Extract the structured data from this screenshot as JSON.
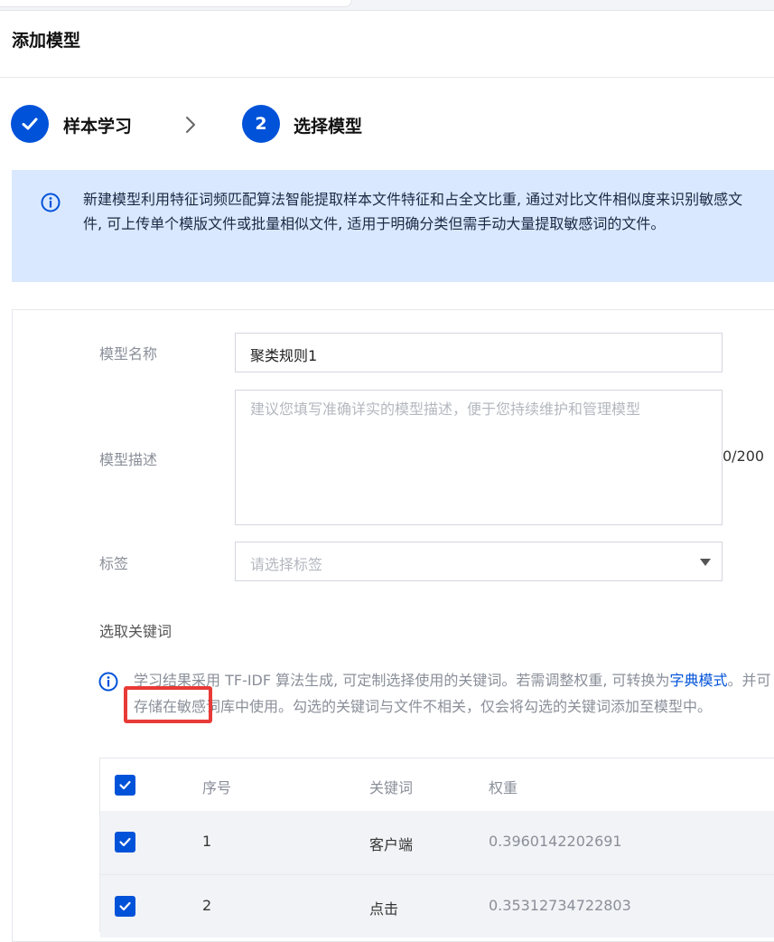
{
  "page": {
    "title": "添加模型"
  },
  "steps": [
    {
      "label": "样本学习",
      "state": "done",
      "icon": "check-icon"
    },
    {
      "label": "选择模型",
      "state": "active",
      "number": "2"
    }
  ],
  "alert": {
    "icon": "info-icon",
    "text": "新建模型利用特征词频匹配算法智能提取样本文件特征和占全文比重, 通过对比文件相似度来识别敏感文件, 可上传单个模版文件或批量相似文件, 适用于明确分类但需手动大量提取敏感词的文件。"
  },
  "form": {
    "name_label": "模型名称",
    "name_value": "聚类规则1",
    "desc_label": "模型描述",
    "desc_placeholder": "建议您填写准确详实的模型描述，便于您持续维护和管理模型",
    "desc_counter": "0/200",
    "tag_label": "标签",
    "tag_placeholder": "请选择标签"
  },
  "keywords": {
    "section_title": "选取关键词",
    "hint_before": "学习结果采用 TF-IDF 算法生成, 可定制选择使用的关键词。若需调整权重, 可转换为",
    "hint_link": "字典模式",
    "hint_after": "。并可存储在敏感词库中使用。勾选的关键词与文件不相关，仅会将勾选的关键词添加至模型中。"
  },
  "table": {
    "headers": {
      "index": "序号",
      "keyword": "关键词",
      "weight": "权重"
    },
    "rows": [
      {
        "index": "1",
        "keyword": "客户端",
        "weight": "0.3960142202691",
        "checked": true
      },
      {
        "index": "2",
        "keyword": "点击",
        "weight": "0.35312734722803",
        "checked": true
      }
    ]
  },
  "colors": {
    "primary": "#0052d9",
    "alert_bg": "#d9e8fe",
    "highlight": "#e83a36"
  }
}
